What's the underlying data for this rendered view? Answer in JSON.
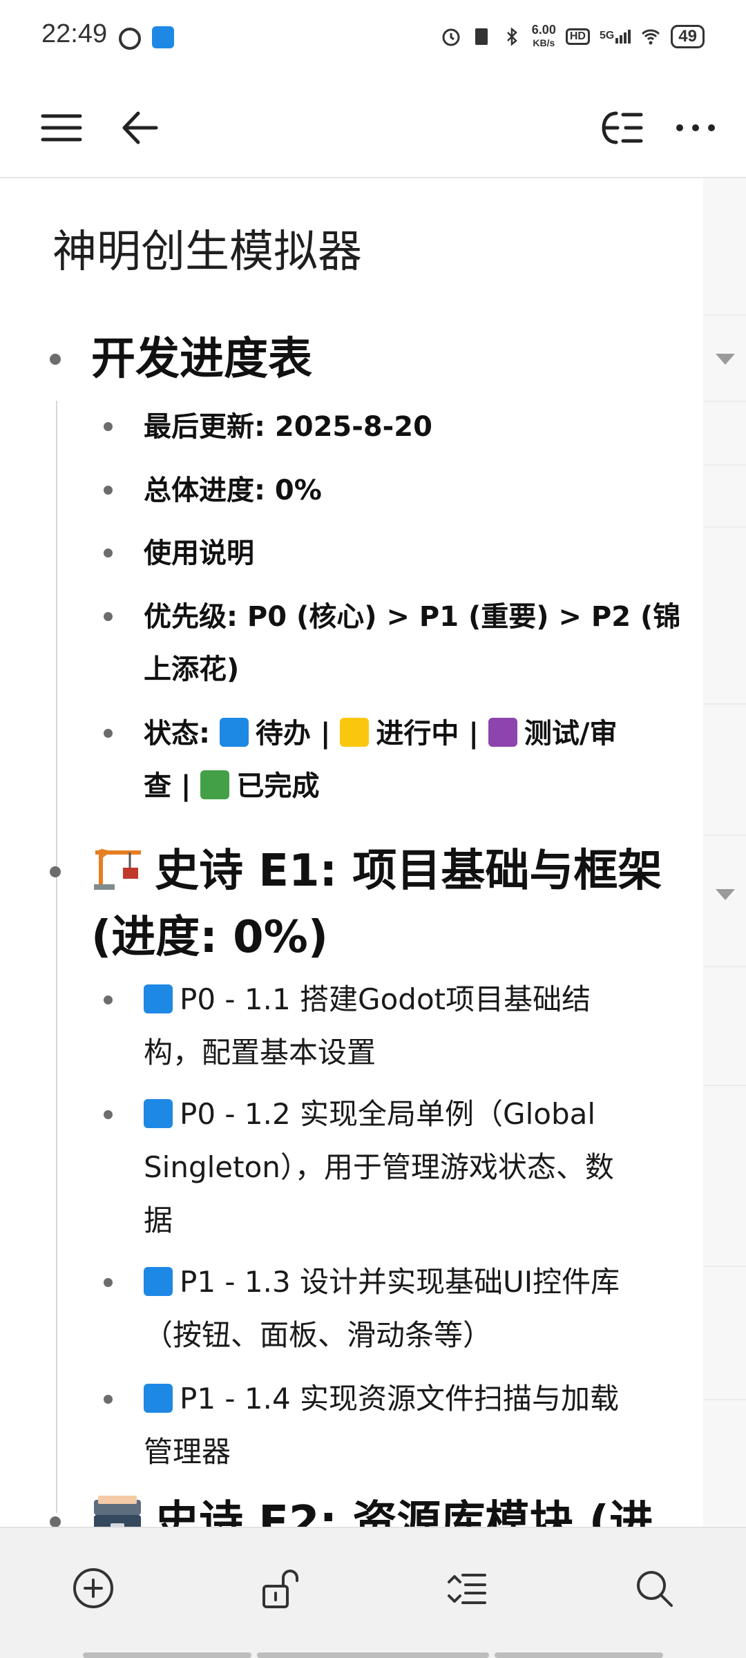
{
  "status_bar": {
    "time": "22:49",
    "network_speed_value": "6.00",
    "network_speed_unit": "KB/s",
    "hd_label": "HD",
    "network_type": "5G",
    "battery": "49",
    "icons": [
      "alarm-icon",
      "app-notification-icon",
      "alarm-icon",
      "sim-icon",
      "bluetooth-icon",
      "signal-icon",
      "wifi-icon",
      "battery-icon"
    ]
  },
  "app_bar": {
    "icons": [
      "menu-icon",
      "back-icon",
      "outline-icon",
      "more-icon"
    ]
  },
  "document": {
    "title": "神明创生模拟器",
    "sections": [
      {
        "heading": "开发进度表",
        "items": [
          {
            "text": "最后更新: 2025-8-20"
          },
          {
            "text": "总体进度: 0%"
          },
          {
            "text": "使用说明"
          },
          {
            "line1": "优先级: P0 (核心) > P1 (重要) > P2 (锦",
            "line2": "上添花)"
          },
          {
            "line1_prefix": "状态: ",
            "pending": "待办",
            "sep1": " | ",
            "in_progress": "进行中",
            "sep2": " | ",
            "testing": "测试/审",
            "line2_prefix": "查",
            "sep3": " | ",
            "done": "已完成"
          }
        ]
      },
      {
        "heading_line1": "史诗 E1: 项目基础与框架",
        "heading_line2": "(进度: 0%)",
        "items": [
          {
            "line1": "P0 - 1.1 搭建Godot项目基础结",
            "line2": "构，配置基本设置"
          },
          {
            "line1": "P0 - 1.2 实现全局单例（Global",
            "line2": "Singleton），用于管理游戏状态、数",
            "line3": "据"
          },
          {
            "line1": "P1 - 1.3 设计并实现基础UI控件库",
            "line2": "（按钮、面板、滑动条等）"
          },
          {
            "line1": "P1 - 1.4 实现资源文件扫描与加载",
            "line2": "管理器"
          }
        ]
      },
      {
        "heading_partial": "史诗 E2: 资源库模块 (进"
      }
    ]
  },
  "toolbar": {
    "icons": [
      "add-circle-icon",
      "unlock-icon",
      "indent-icon",
      "search-icon"
    ]
  },
  "colors": {
    "status_pending": "#1e88e5",
    "status_in_progress": "#f9c80e",
    "status_testing": "#8e44ad",
    "status_done": "#43a047"
  }
}
